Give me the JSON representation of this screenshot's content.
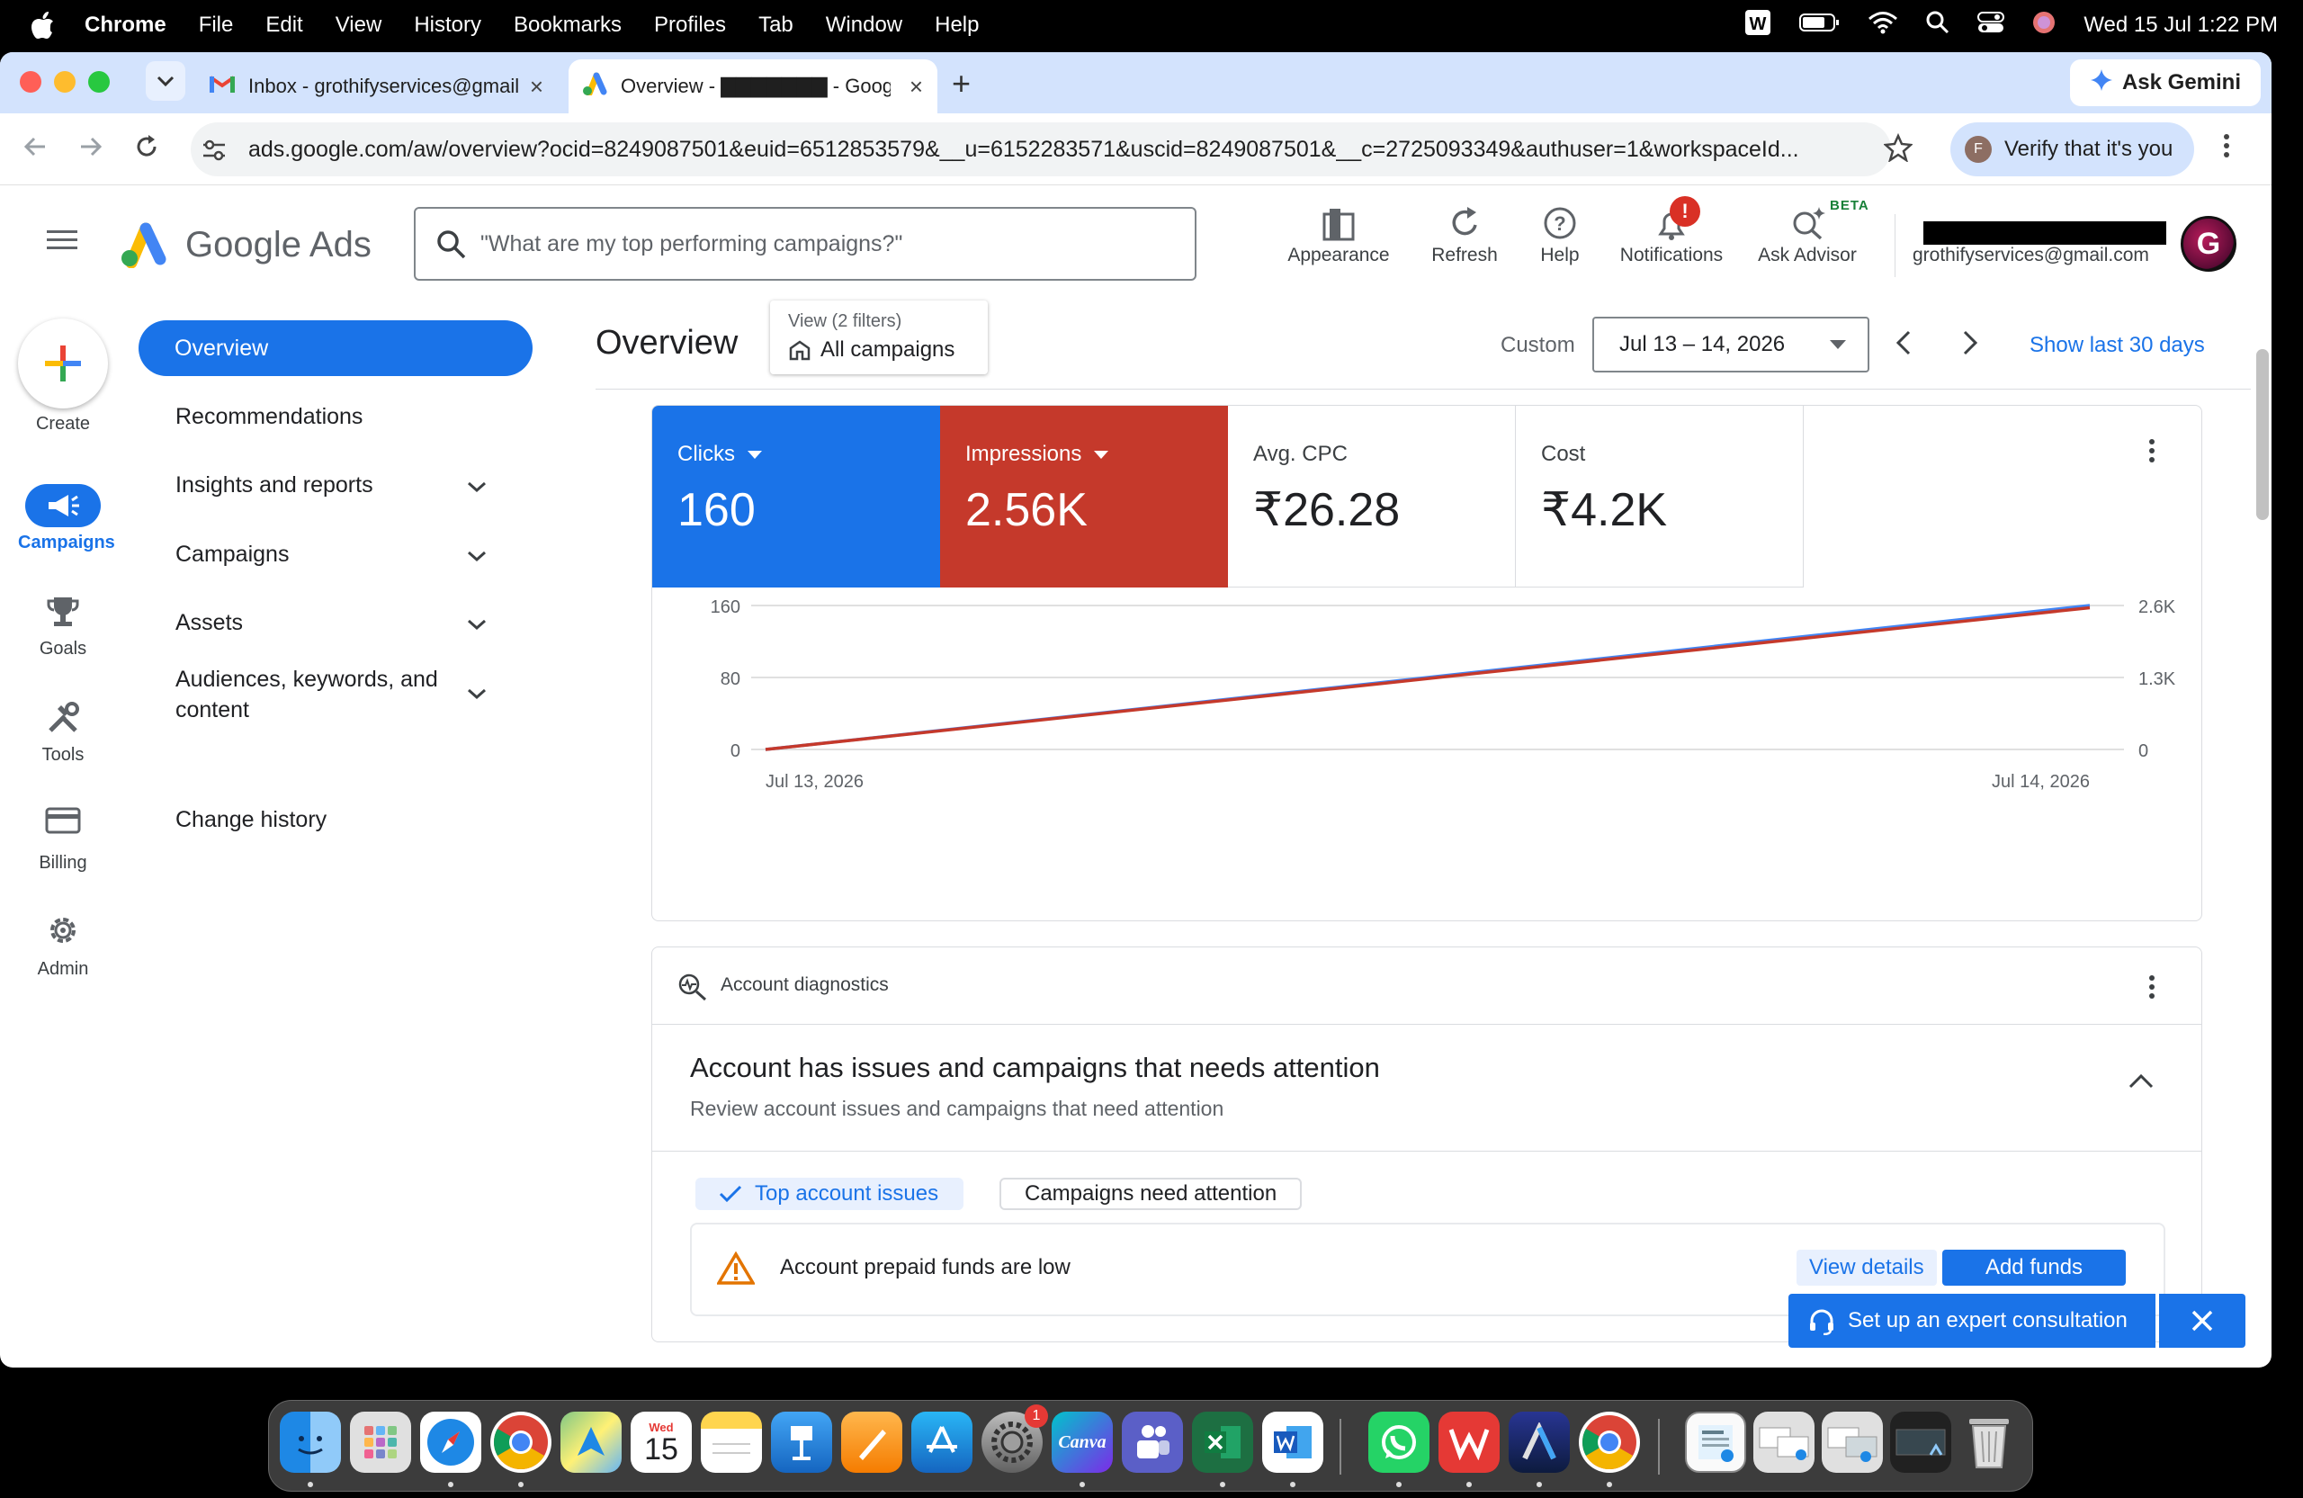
{
  "menubar": {
    "app": "Chrome",
    "items": [
      "File",
      "Edit",
      "View",
      "History",
      "Bookmarks",
      "Profiles",
      "Tab",
      "Window",
      "Help"
    ],
    "datetime": "Wed 15 Jul  1:22 PM"
  },
  "browser": {
    "tabs": [
      {
        "title": "Inbox - grothifyservices@gmail.com",
        "icon": "gmail-icon"
      },
      {
        "title": "Overview - ▇▇▇▇▇▇▇ - Google Ads",
        "icon": "google-ads-icon"
      }
    ],
    "ask_gemini": "Ask Gemini",
    "url": "ads.google.com/aw/overview?ocid=8249087501&euid=6512853579&__u=6152283571&uscid=8249087501&__c=2725093349&authuser=1&workspaceId...",
    "verify": "Verify that it's you",
    "verify_avatar": "F"
  },
  "ads_header": {
    "logo": "Google Ads",
    "search_placeholder": "\"What are my top performing campaigns?\"",
    "buttons": {
      "appearance": "Appearance",
      "refresh": "Refresh",
      "help": "Help",
      "notifications": "Notifications",
      "ask_advisor": "Ask Advisor"
    },
    "beta": "BETA",
    "notif_badge": "!",
    "email": "grothifyservices@gmail.com",
    "avatar_letter": "G"
  },
  "rail": {
    "create": "Create",
    "campaigns": "Campaigns",
    "goals": "Goals",
    "tools": "Tools",
    "billing": "Billing",
    "admin": "Admin"
  },
  "sidenav": {
    "overview": "Overview",
    "recommendations": "Recommendations",
    "insights": "Insights and reports",
    "campaigns": "Campaigns",
    "assets": "Assets",
    "audiences_line1": "Audiences, keywords, and",
    "audiences_line2": "content",
    "change_history": "Change history"
  },
  "overview": {
    "title": "Overview",
    "view_sub": "View (2 filters)",
    "view_main": "All campaigns",
    "custom": "Custom",
    "date_range": "Jul 13 – 14, 2026",
    "show_last": "Show last 30 days"
  },
  "metrics": {
    "clicks": {
      "label": "Clicks",
      "value": "160"
    },
    "impressions": {
      "label": "Impressions",
      "value": "2.56K"
    },
    "avg_cpc": {
      "label": "Avg. CPC",
      "value": "₹26.28"
    },
    "cost": {
      "label": "Cost",
      "value": "₹4.2K"
    }
  },
  "chart_data": {
    "type": "line",
    "x": [
      "Jul 13, 2026",
      "Jul 14, 2026"
    ],
    "series": [
      {
        "name": "Clicks",
        "values": [
          0,
          160
        ],
        "color": "#4285f4",
        "axis": "left"
      },
      {
        "name": "Impressions",
        "values": [
          0,
          2560
        ],
        "color": "#c5392b",
        "axis": "right"
      }
    ],
    "left_ticks": [
      "0",
      "80",
      "160"
    ],
    "right_ticks": [
      "0",
      "1.3K",
      "2.6K"
    ],
    "ylim_left": [
      0,
      160
    ],
    "ylim_right": [
      0,
      2600
    ],
    "grid": true
  },
  "diagnostics": {
    "header": "Account diagnostics",
    "issue_title": "Account has issues and campaigns that needs attention",
    "issue_sub": "Review account issues and campaigns that need attention",
    "chip_top": "Top account issues",
    "chip_campaigns": "Campaigns need attention",
    "alert_text": "Account prepaid funds are low",
    "view_details": "View details",
    "add_funds": "Add funds"
  },
  "consult": {
    "label": "Set up an expert consultation"
  },
  "dock": {
    "apps": [
      "Finder",
      "Launchpad",
      "Safari",
      "Chrome",
      "Maps",
      "Calendar",
      "Notes",
      "Keynote",
      "Pages",
      "App Store",
      "System Settings",
      "Canva",
      "Teams",
      "Excel",
      "Word",
      "WhatsApp",
      "WPS Office",
      "Arc",
      "Chrome",
      "Downloads",
      "Screenshots",
      "Screenshots 2",
      "Desktop",
      "Trash"
    ],
    "calendar_day": "Wed",
    "calendar_date": "15",
    "settings_badge": "1",
    "canva_label": "Canva"
  }
}
